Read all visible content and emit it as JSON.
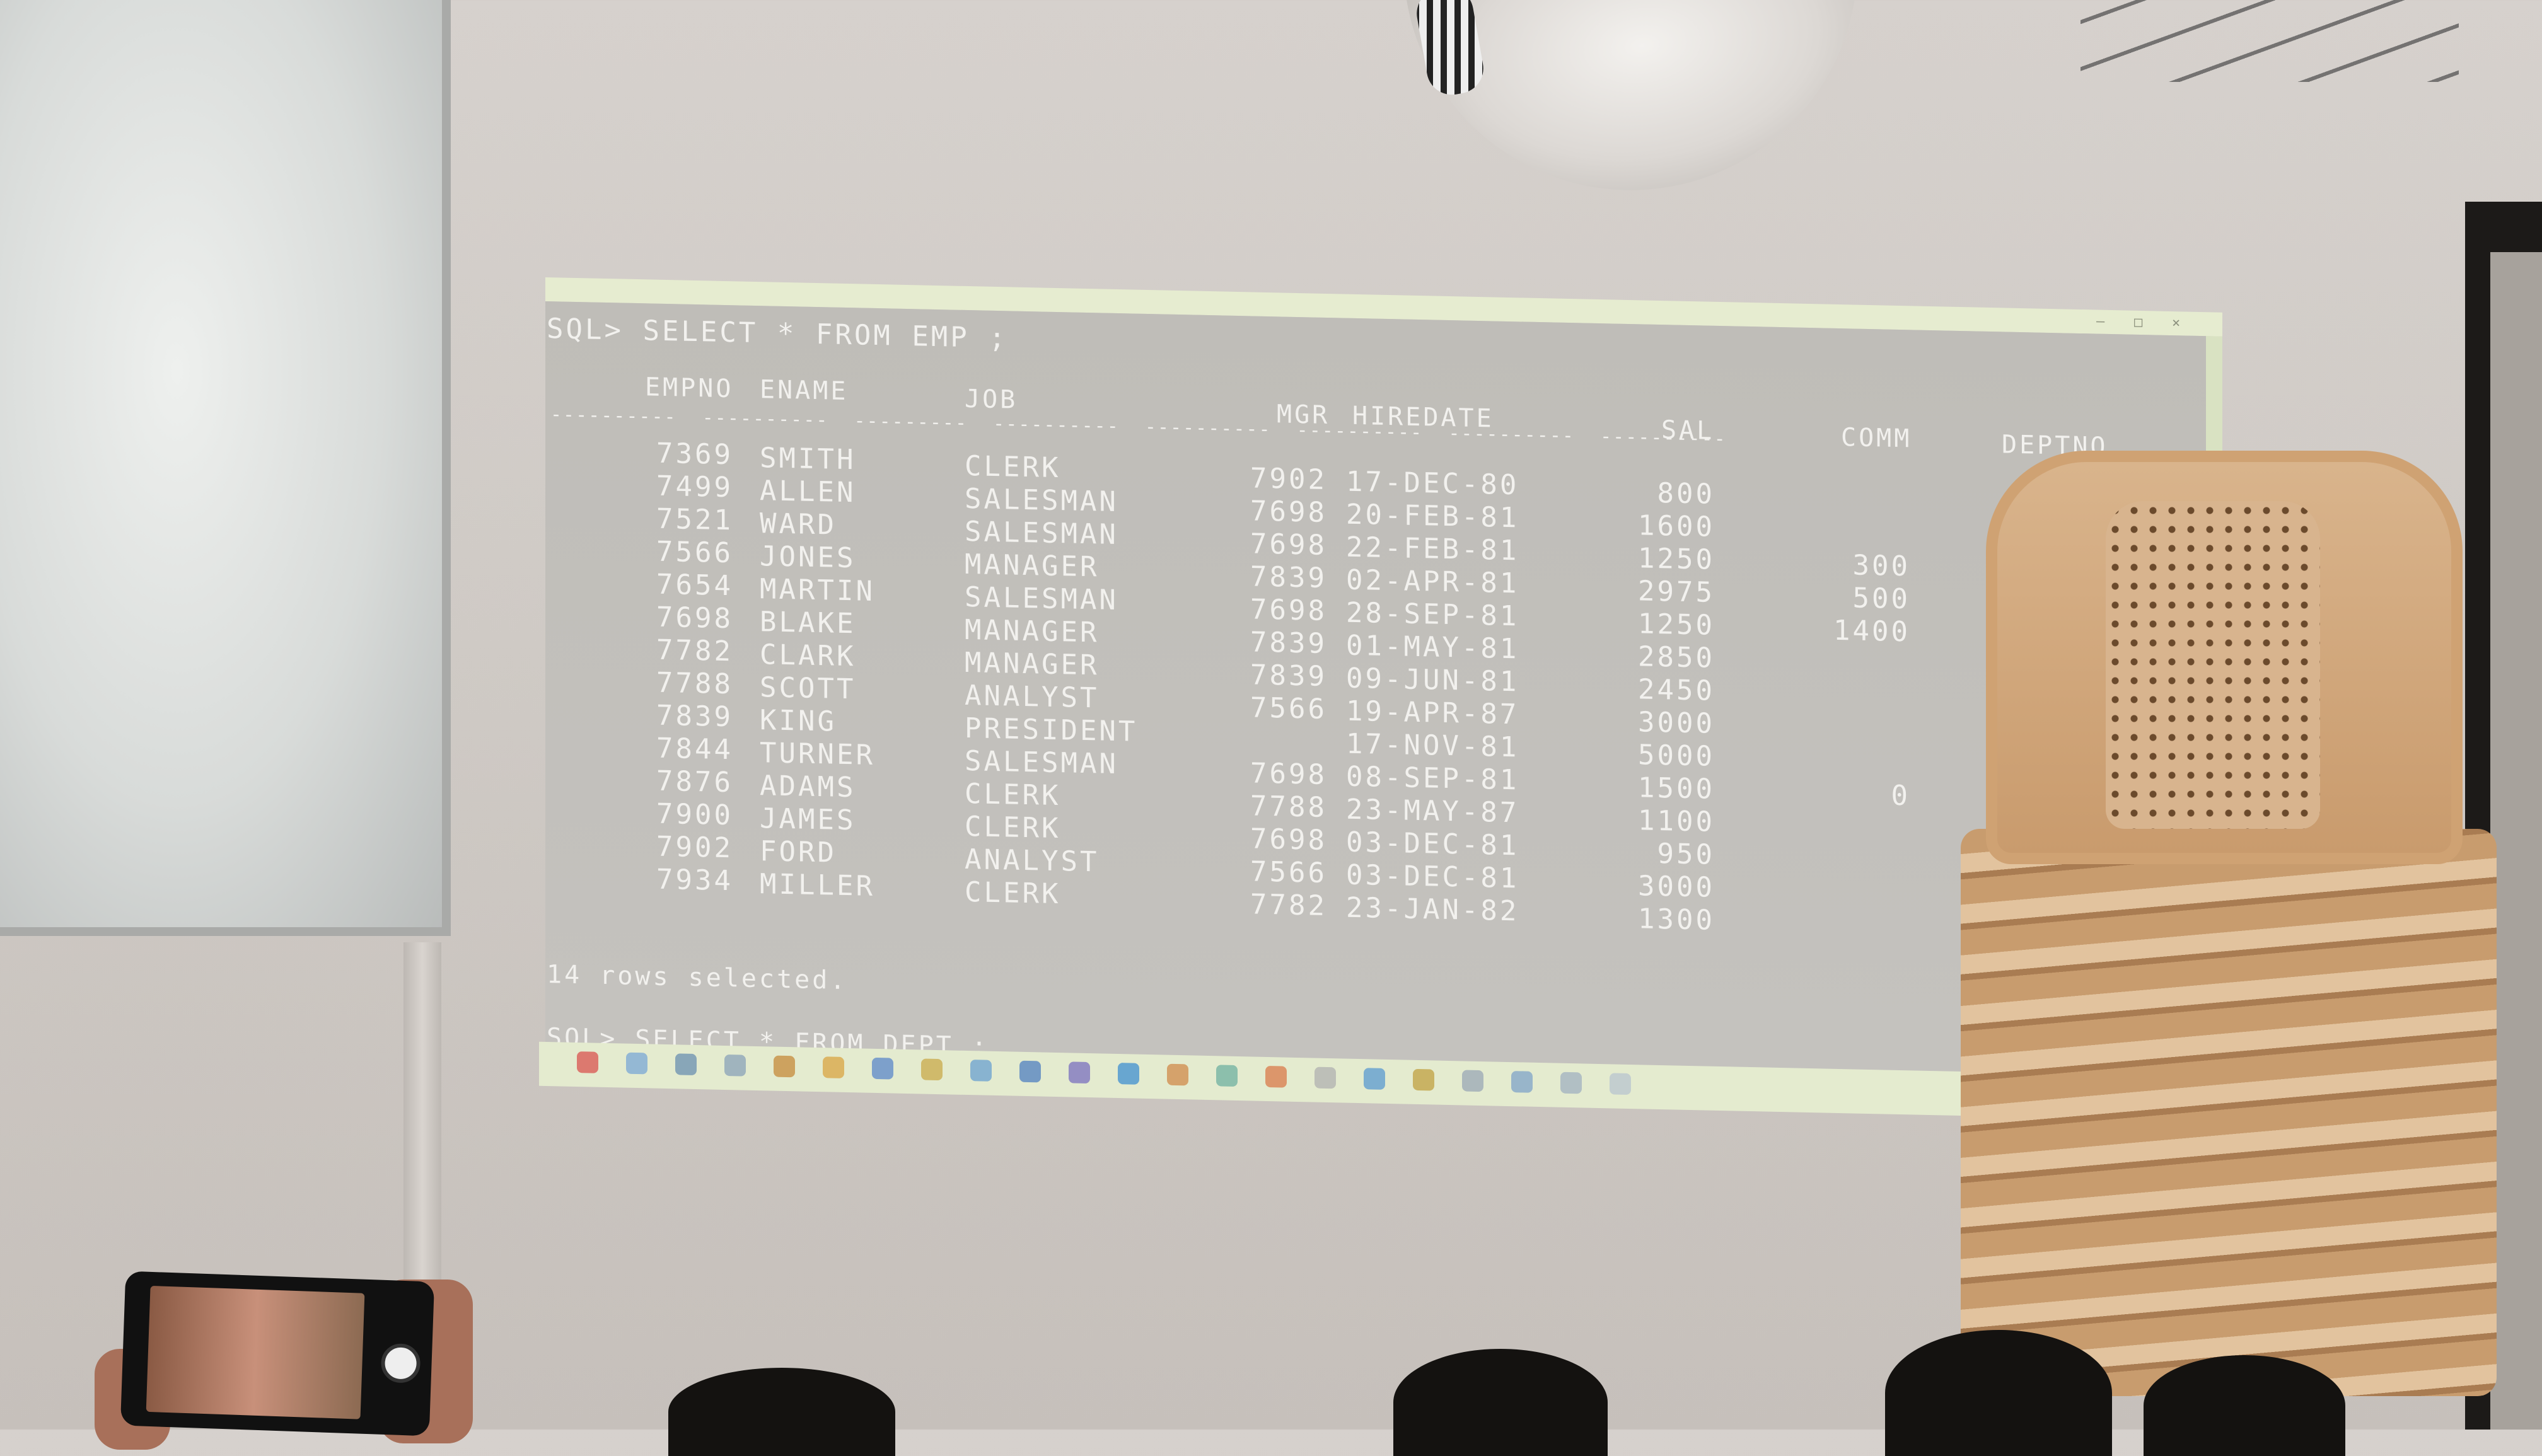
{
  "console": {
    "prompt1": "SQL> SELECT * FROM EMP ;",
    "headers": {
      "empno": "EMPNO",
      "ename": "ENAME",
      "job": "JOB",
      "mgr": "MGR",
      "hiredate": "HIREDATE",
      "sal": "SAL",
      "comm": "COMM",
      "deptno": "DEPTNO"
    },
    "rows": [
      {
        "empno": "7369",
        "ename": "SMITH",
        "job": "CLERK",
        "mgr": "7902",
        "hiredate": "17-DEC-80",
        "sal": "800",
        "comm": ""
      },
      {
        "empno": "7499",
        "ename": "ALLEN",
        "job": "SALESMAN",
        "mgr": "7698",
        "hiredate": "20-FEB-81",
        "sal": "1600",
        "comm": ""
      },
      {
        "empno": "7521",
        "ename": "WARD",
        "job": "SALESMAN",
        "mgr": "7698",
        "hiredate": "22-FEB-81",
        "sal": "1250",
        "comm": "300"
      },
      {
        "empno": "7566",
        "ename": "JONES",
        "job": "MANAGER",
        "mgr": "7839",
        "hiredate": "02-APR-81",
        "sal": "2975",
        "comm": "500"
      },
      {
        "empno": "7654",
        "ename": "MARTIN",
        "job": "SALESMAN",
        "mgr": "7698",
        "hiredate": "28-SEP-81",
        "sal": "1250",
        "comm": "1400"
      },
      {
        "empno": "7698",
        "ename": "BLAKE",
        "job": "MANAGER",
        "mgr": "7839",
        "hiredate": "01-MAY-81",
        "sal": "2850",
        "comm": ""
      },
      {
        "empno": "7782",
        "ename": "CLARK",
        "job": "MANAGER",
        "mgr": "7839",
        "hiredate": "09-JUN-81",
        "sal": "2450",
        "comm": ""
      },
      {
        "empno": "7788",
        "ename": "SCOTT",
        "job": "ANALYST",
        "mgr": "7566",
        "hiredate": "19-APR-87",
        "sal": "3000",
        "comm": ""
      },
      {
        "empno": "7839",
        "ename": "KING",
        "job": "PRESIDENT",
        "mgr": "",
        "hiredate": "17-NOV-81",
        "sal": "5000",
        "comm": ""
      },
      {
        "empno": "7844",
        "ename": "TURNER",
        "job": "SALESMAN",
        "mgr": "7698",
        "hiredate": "08-SEP-81",
        "sal": "1500",
        "comm": "0"
      },
      {
        "empno": "7876",
        "ename": "ADAMS",
        "job": "CLERK",
        "mgr": "7788",
        "hiredate": "23-MAY-87",
        "sal": "1100",
        "comm": ""
      },
      {
        "empno": "7900",
        "ename": "JAMES",
        "job": "CLERK",
        "mgr": "7698",
        "hiredate": "03-DEC-81",
        "sal": "950",
        "comm": ""
      },
      {
        "empno": "7902",
        "ename": "FORD",
        "job": "ANALYST",
        "mgr": "7566",
        "hiredate": "03-DEC-81",
        "sal": "3000",
        "comm": ""
      },
      {
        "empno": "7934",
        "ename": "MILLER",
        "job": "CLERK",
        "mgr": "7782",
        "hiredate": "23-JAN-82",
        "sal": "1300",
        "comm": ""
      }
    ],
    "rows_selected": "14 rows selected.",
    "prompt2": "SQL> SELECT * FROM DEPT ;"
  },
  "colors": {
    "console_bg": "#c2c0bb",
    "console_text": "#f2f1ee",
    "window_frame": "#e4ebcf"
  },
  "taskbar_icons": [
    "start-icon",
    "widgets-icon",
    "search-icon",
    "task-view-icon",
    "settings-icon",
    "chrome-icon",
    "edge-icon",
    "explorer-icon",
    "store-icon",
    "mail-icon",
    "teams-icon",
    "vscode-icon",
    "app-icon",
    "app-icon",
    "app-icon",
    "app-icon",
    "app-icon",
    "app-icon",
    "app-icon",
    "app-icon",
    "app-icon",
    "app-icon"
  ]
}
